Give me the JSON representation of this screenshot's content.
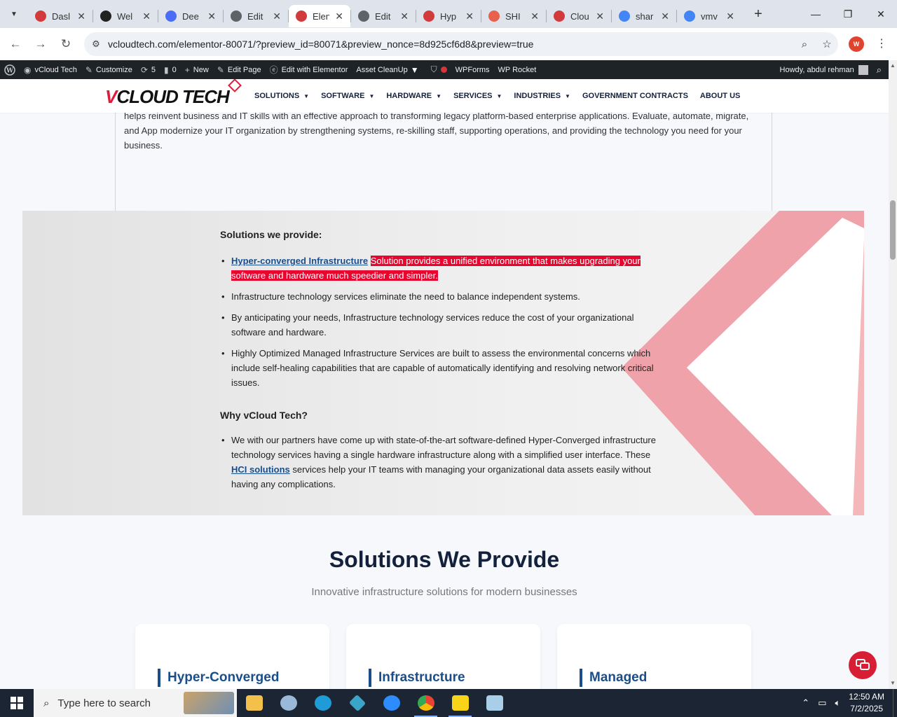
{
  "browser": {
    "tabs": [
      {
        "title": "Dasl",
        "color": "#d13b3b"
      },
      {
        "title": "Wel",
        "color": "#222222"
      },
      {
        "title": "Dee",
        "color": "#4a6cf7"
      },
      {
        "title": "Edit",
        "color": "#5f6368"
      },
      {
        "title": "Elen",
        "color": "#d13b3b"
      },
      {
        "title": "Edit",
        "color": "#5f6368"
      },
      {
        "title": "Hyp",
        "color": "#d13b3b"
      },
      {
        "title": "SHI",
        "color": "#e8614a"
      },
      {
        "title": "Clou",
        "color": "#d13b3b"
      },
      {
        "title": "shar",
        "color": "#4285f4"
      },
      {
        "title": "vmv",
        "color": "#4285f4"
      }
    ],
    "active_tab_index": 4,
    "url": "vcloudtech.com/elementor-80071/?preview_id=80071&preview_nonce=8d925cf6d8&preview=true",
    "profile_initial": "W"
  },
  "adminbar": {
    "site": "vCloud Tech",
    "customize": "Customize",
    "updates": "5",
    "comments": "0",
    "new": "New",
    "edit_page": "Edit Page",
    "edit_elementor": "Edit with Elementor",
    "asset_cleanup": "Asset CleanUp",
    "wpforms": "WPForms",
    "wprocket": "WP Rocket",
    "howdy": "Howdy, abdul rehman"
  },
  "site": {
    "logo_v": "V",
    "logo_text": "CLOUD TECH",
    "nav": [
      {
        "label": "SOLUTIONS",
        "dropdown": true
      },
      {
        "label": "SOFTWARE",
        "dropdown": true
      },
      {
        "label": "HARDWARE",
        "dropdown": true
      },
      {
        "label": "SERVICES",
        "dropdown": true
      },
      {
        "label": "INDUSTRIES",
        "dropdown": true
      },
      {
        "label": "GOVERNMENT CONTRACTS",
        "dropdown": false
      },
      {
        "label": "ABOUT US",
        "dropdown": false
      }
    ]
  },
  "intro_text": "helps reinvent business and IT skills with an effective approach to transforming legacy platform-based enterprise applications. Evaluate, automate, migrate, and App modernize your IT organization by strengthening systems, re-skilling staff, supporting operations, and providing the technology you need for your business.",
  "solutions": {
    "heading": "Solutions we provide:",
    "item1_link": "Hyper-converged Infrastructure",
    "item1_highlight": "Solution provides a unified environment that makes upgrading your software and hardware much speedier and simpler.",
    "item2": "Infrastructure technology services eliminate the need to balance independent systems.",
    "item3": "By anticipating your needs, Infrastructure technology services reduce the cost of your organizational software and hardware.",
    "item4": "Highly Optimized Managed Infrastructure Services are built to assess the environmental concerns which include self-healing capabilities that are capable of automatically identifying and resolving network critical issues.",
    "why_heading": "Why vCloud Tech?",
    "why_pre": "We with our partners have come up with state-of-the-art software-defined Hyper-Converged infrastructure technology services having a single hardware infrastructure along with a simplified user interface. These ",
    "why_link": "HCI solutions",
    "why_post": " services help your IT teams with managing your organizational data assets easily without having any complications."
  },
  "section": {
    "title": "Solutions We Provide",
    "subtitle": "Innovative infrastructure solutions for modern businesses",
    "cards": [
      {
        "title": "Hyper-Converged"
      },
      {
        "title": "Infrastructure"
      },
      {
        "title": "Managed"
      }
    ]
  },
  "taskbar": {
    "search_placeholder": "Type here to search",
    "time": "12:50 AM",
    "date": "7/2/2025"
  },
  "colors": {
    "accent_red": "#e01a3a",
    "brand_navy": "#14213d",
    "link_blue": "#1a4e8a"
  }
}
